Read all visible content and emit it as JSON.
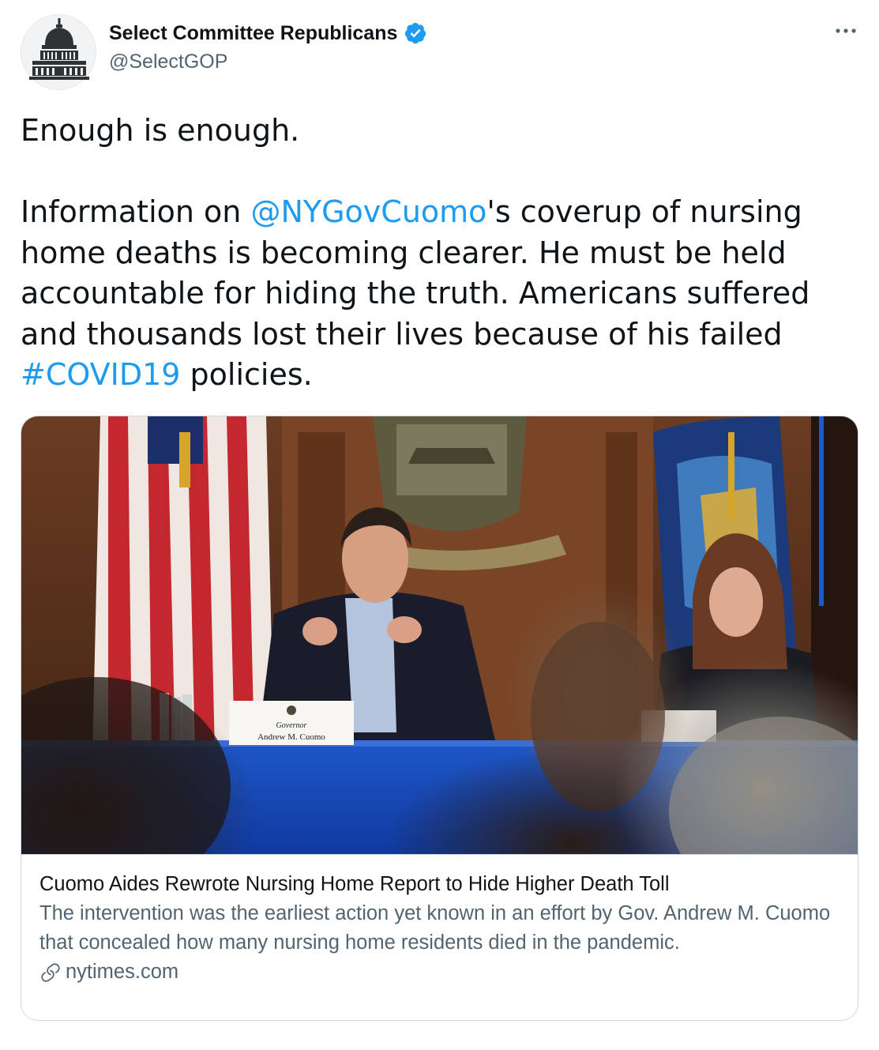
{
  "author": {
    "display_name": "Select Committee Republicans",
    "handle": "@SelectGOP",
    "avatar_icon": "capitol-dome-icon",
    "verified_icon": "verified-badge-icon"
  },
  "menu_icon": "more-options-icon",
  "tweet": {
    "line1": "Enough is enough.",
    "p2_pre": "Information on ",
    "mention": "@NYGovCuomo",
    "p2_mid": "'s coverup of nursing home deaths is becoming clearer. He must be held accountable for hiding the truth. Americans suffered and thousands lost their lives because of his failed ",
    "hashtag": "#COVID19",
    "p2_end": " policies."
  },
  "card": {
    "placard_line1": "Governor",
    "placard_line2": "Andrew M. Cuomo",
    "title": "Cuomo Aides Rewrote Nursing Home Report to Hide Higher Death Toll",
    "description": "The intervention was the earliest action yet known in an effort by Gov. Andrew M. Cuomo that concealed how many nursing home residents died in the pandemic.",
    "domain": "nytimes.com",
    "domain_icon": "link-icon"
  },
  "colors": {
    "accent": "#1d9bf0",
    "secondary_text": "#536471",
    "border": "#cfd9de"
  }
}
